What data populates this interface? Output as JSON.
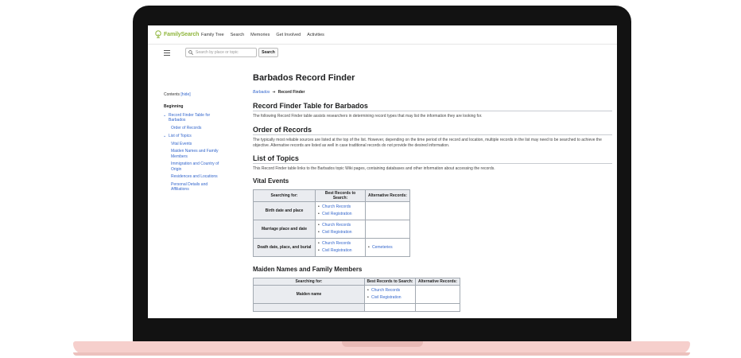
{
  "nav": {
    "logo": "FamilySearch",
    "items": [
      "Family Tree",
      "Search",
      "Memories",
      "Get Involved",
      "Activities"
    ]
  },
  "search": {
    "placeholder": "Search by place or topic",
    "button": "Search"
  },
  "toc": {
    "contents": "Contents",
    "hide": "[hide]",
    "items": [
      "Beginning",
      "Record Finder Table for Barbados",
      "Order of Records",
      "List of Topics",
      "Vital Events",
      "Maiden Names and Family Members",
      "Immigration and Country of Origin",
      "Residences and Locations",
      "Personal Details and Affiliations"
    ]
  },
  "page": {
    "title": "Barbados Record Finder",
    "breadcrumb_link": "Barbados",
    "breadcrumb_current": "Record Finder"
  },
  "sections": {
    "table_heading": "Record Finder Table for Barbados",
    "table_text": "The following Record Finder table assists researchers in determining record types that may list the information they are looking for.",
    "order_heading": "Order of Records",
    "order_text": "The typically most reliable sources are listed at the top of the list. However, depending on the time period of the record and location, multiple records in the list may need to be searched to achieve the objective. Alternative records are listed as well in case traditional records do not provide the desired information.",
    "topics_heading": "List of Topics",
    "topics_text": "This Record Finder table links to the Barbados topic Wiki pages, containing databases and other information about accessing the records."
  },
  "vital": {
    "heading": "Vital Events",
    "headers": [
      "Searching for:",
      "Best Records to Search:",
      "Alternative Records:"
    ],
    "rows": [
      {
        "label": "Birth date and place",
        "best": [
          "Church Records",
          "Civil Registration"
        ],
        "alt": []
      },
      {
        "label": "Marriage place and date",
        "best": [
          "Church Records",
          "Civil Registration"
        ],
        "alt": []
      },
      {
        "label": "Death date, place, and burial",
        "best": [
          "Church Records",
          "Civil Registration"
        ],
        "alt": [
          "Cemeteries"
        ]
      }
    ]
  },
  "maiden": {
    "heading": "Maiden Names and Family Members",
    "headers": [
      "Searching for:",
      "Best Records to Search:",
      "Alternative Records:"
    ],
    "rows": [
      {
        "label": "Maiden name",
        "best": [
          "Church Records",
          "Civil Registration"
        ],
        "alt": []
      }
    ]
  }
}
